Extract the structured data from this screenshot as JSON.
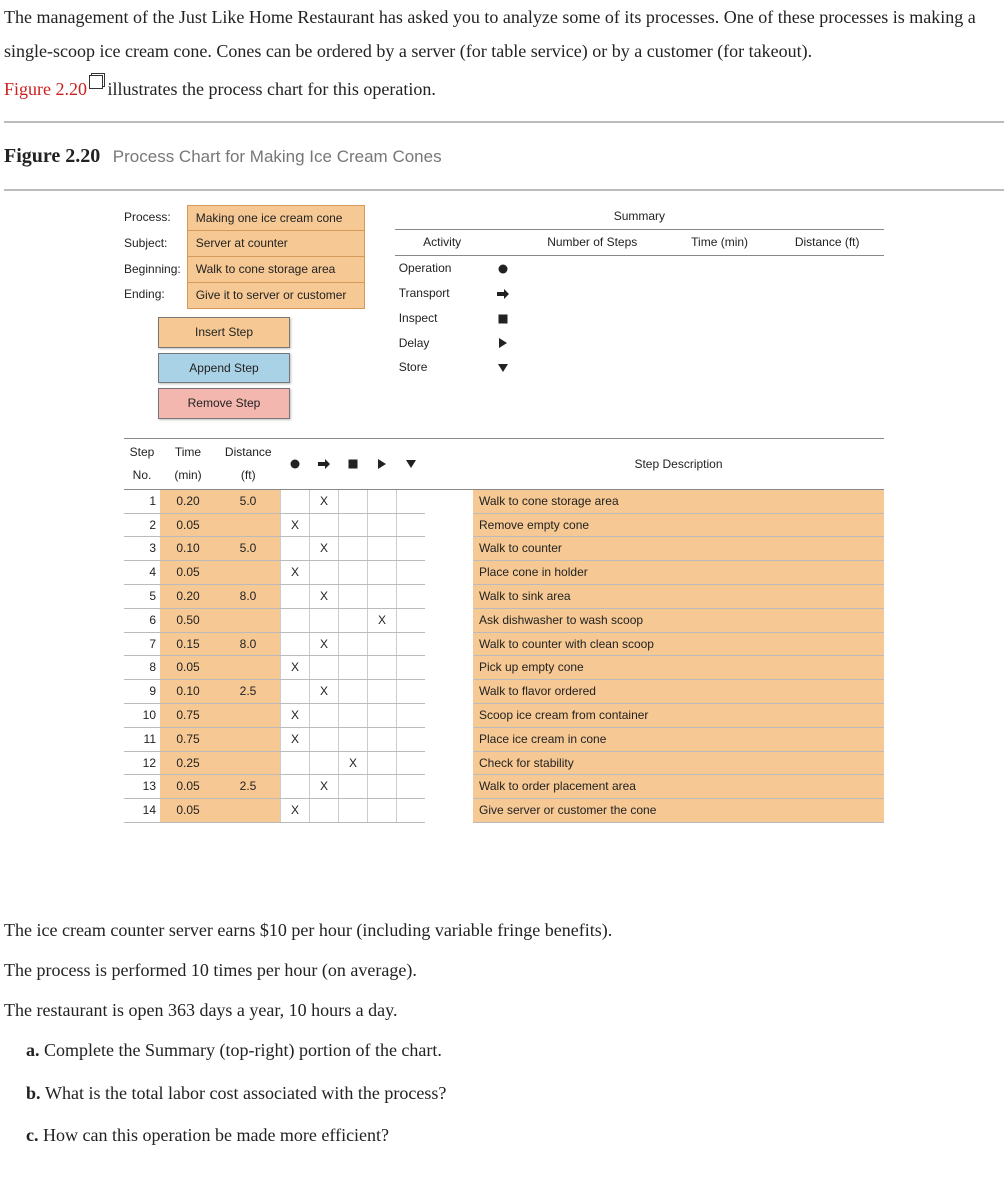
{
  "intro": {
    "p1": "The management of the Just Like Home Restaurant has asked you to analyze some of its processes. One of these processes is making a single-scoop ice cream cone. Cones can be ordered by a server (for table service) or by a customer (for takeout).",
    "link": "Figure 2.20",
    "p2_tail": " illustrates the process chart for this operation."
  },
  "figure": {
    "number": "Figure 2.20",
    "title": "Process Chart for Making Ice Cream Cones"
  },
  "meta": {
    "process_lbl": "Process:",
    "process_val": "Making one ice cream cone",
    "subject_lbl": "Subject:",
    "subject_val": "Server at counter",
    "begin_lbl": "Beginning:",
    "begin_val": "Walk to cone storage area",
    "end_lbl": "Ending:",
    "end_val": "Give it to server or customer"
  },
  "buttons": {
    "insert": "Insert Step",
    "append": "Append Step",
    "remove": "Remove Step"
  },
  "summary": {
    "title": "Summary",
    "h_activity": "Activity",
    "h_num": "Number of Steps",
    "h_time": "Time (min)",
    "h_dist": "Distance (ft)",
    "rows": [
      {
        "label": "Operation",
        "icon": "circle"
      },
      {
        "label": "Transport",
        "icon": "arrow"
      },
      {
        "label": "Inspect",
        "icon": "square"
      },
      {
        "label": "Delay",
        "icon": "tri-right"
      },
      {
        "label": "Store",
        "icon": "tri-down"
      }
    ]
  },
  "step_header": {
    "no": "Step No.",
    "time": "Time (min)",
    "dist": "Distance (ft)",
    "desc": "Step Description"
  },
  "chart_data": {
    "type": "table",
    "columns": [
      "Step No.",
      "Time (min)",
      "Distance (ft)",
      "Operation",
      "Transport",
      "Inspect",
      "Delay",
      "Store",
      "Step Description"
    ],
    "rows": [
      {
        "no": 1,
        "time": "0.20",
        "dist": "5.0",
        "marks": [
          "",
          "X",
          "",
          "",
          ""
        ],
        "desc": "Walk to cone storage area"
      },
      {
        "no": 2,
        "time": "0.05",
        "dist": "",
        "marks": [
          "X",
          "",
          "",
          "",
          ""
        ],
        "desc": "Remove empty cone"
      },
      {
        "no": 3,
        "time": "0.10",
        "dist": "5.0",
        "marks": [
          "",
          "X",
          "",
          "",
          ""
        ],
        "desc": "Walk to counter"
      },
      {
        "no": 4,
        "time": "0.05",
        "dist": "",
        "marks": [
          "X",
          "",
          "",
          "",
          ""
        ],
        "desc": "Place cone in holder"
      },
      {
        "no": 5,
        "time": "0.20",
        "dist": "8.0",
        "marks": [
          "",
          "X",
          "",
          "",
          ""
        ],
        "desc": "Walk to sink area"
      },
      {
        "no": 6,
        "time": "0.50",
        "dist": "",
        "marks": [
          "",
          "",
          "",
          "X",
          ""
        ],
        "desc": "Ask dishwasher to wash scoop"
      },
      {
        "no": 7,
        "time": "0.15",
        "dist": "8.0",
        "marks": [
          "",
          "X",
          "",
          "",
          ""
        ],
        "desc": "Walk to counter with clean scoop"
      },
      {
        "no": 8,
        "time": "0.05",
        "dist": "",
        "marks": [
          "X",
          "",
          "",
          "",
          ""
        ],
        "desc": "Pick up empty cone"
      },
      {
        "no": 9,
        "time": "0.10",
        "dist": "2.5",
        "marks": [
          "",
          "X",
          "",
          "",
          ""
        ],
        "desc": "Walk to flavor ordered"
      },
      {
        "no": 10,
        "time": "0.75",
        "dist": "",
        "marks": [
          "X",
          "",
          "",
          "",
          ""
        ],
        "desc": "Scoop ice cream from container"
      },
      {
        "no": 11,
        "time": "0.75",
        "dist": "",
        "marks": [
          "X",
          "",
          "",
          "",
          ""
        ],
        "desc": "Place ice cream in cone"
      },
      {
        "no": 12,
        "time": "0.25",
        "dist": "",
        "marks": [
          "",
          "",
          "X",
          "",
          ""
        ],
        "desc": "Check for stability"
      },
      {
        "no": 13,
        "time": "0.05",
        "dist": "2.5",
        "marks": [
          "",
          "X",
          "",
          "",
          ""
        ],
        "desc": "Walk to order placement area"
      },
      {
        "no": 14,
        "time": "0.05",
        "dist": "",
        "marks": [
          "X",
          "",
          "",
          "",
          ""
        ],
        "desc": "Give server or customer the cone"
      }
    ]
  },
  "after": {
    "p1": "The ice cream counter server earns $10 per hour (including variable fringe benefits).",
    "p2": "The process is performed 10 times per hour (on average).",
    "p3": "The restaurant is open 363 days a year, 10 hours a day.",
    "qa_lbl": "a. ",
    "qa": "Complete the Summary (top-right) portion of the chart.",
    "qb_lbl": "b. ",
    "qb": "What is the total labor cost associated with the process?",
    "qc_lbl": "c. ",
    "qc": "How can this operation be made more efficient?"
  }
}
